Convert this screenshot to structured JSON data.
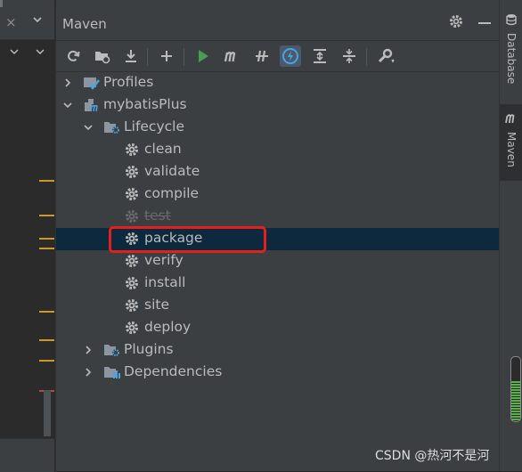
{
  "panel": {
    "title": "Maven"
  },
  "left_strip": {
    "close_glyph": "×",
    "dropdown_glyph": "⌄",
    "row_glyphs": [
      "⌃",
      "⌄"
    ]
  },
  "toolbar": {
    "buttons": [
      "reload-icon",
      "generate-sources-icon",
      "download-icon",
      "add-icon",
      "run-icon",
      "maven-goal-icon",
      "toggle-offline-icon",
      "skip-tests-icon",
      "expand-all-icon",
      "collapse-all-icon",
      "settings-wrench-icon"
    ]
  },
  "tree": {
    "profiles": "Profiles",
    "project": "mybatisPlus",
    "lifecycle": "Lifecycle",
    "goals": [
      "clean",
      "validate",
      "compile",
      "test",
      "package",
      "verify",
      "install",
      "site",
      "deploy"
    ],
    "plugins": "Plugins",
    "dependencies": "Dependencies",
    "selected_goal": "package",
    "disabled_goal": "test"
  },
  "right_strip": {
    "tab_database": "Database",
    "tab_maven": "Maven",
    "memory_fraction": 0.62
  },
  "watermark": "CSDN @热河不是河",
  "colors": {
    "selection": "#0d293e",
    "highlight": "#e5201c",
    "run_green": "#499c54",
    "active_toggle": "#4a5a6c"
  }
}
